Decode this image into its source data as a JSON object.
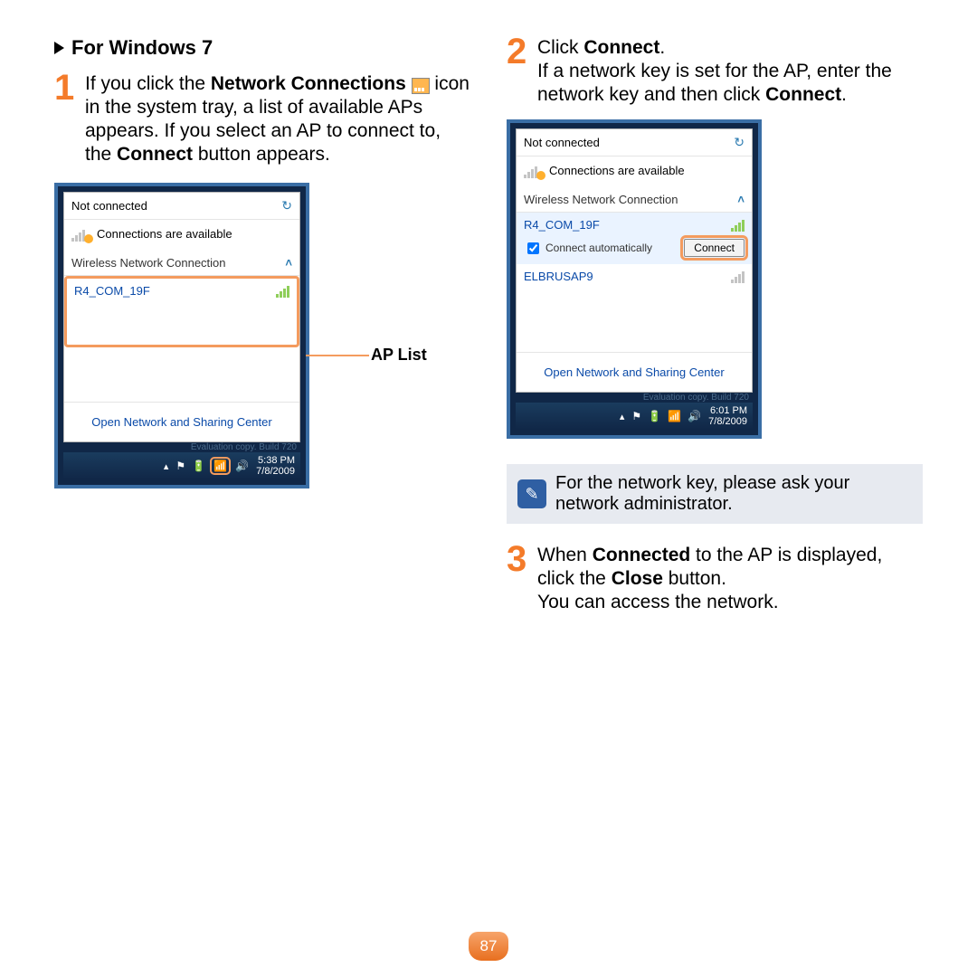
{
  "left": {
    "heading": "For Windows 7",
    "step1_num": "1",
    "step1_a": "If you click the ",
    "step1_b": "Network Connections",
    "step1_c": " icon in the system tray, a list of available APs appears. If you select an AP to connect to, the ",
    "step1_d": "Connect",
    "step1_e": " button appears.",
    "callout": "AP List",
    "popup": {
      "status": "Not connected",
      "avail": "Connections are available",
      "header": "Wireless Network Connection",
      "ap1": "R4_COM_19F",
      "open_center": "Open Network and Sharing Center",
      "eval": "Evaluation copy. Build 720",
      "time": "5:38 PM",
      "date": "7/8/2009"
    }
  },
  "right": {
    "step2_num": "2",
    "step2_a": "Click ",
    "step2_b": "Connect",
    "step2_c": ".",
    "step2_d": "If a network key is set for the AP, enter the network key and then click ",
    "step2_e": "Connect",
    "step2_f": ".",
    "popup": {
      "status": "Not connected",
      "avail": "Connections are available",
      "header": "Wireless Network Connection",
      "ap1": "R4_COM_19F",
      "auto": "Connect automatically",
      "connect": "Connect",
      "ap2": "ELBRUSAP9",
      "open_center": "Open Network and Sharing Center",
      "eval": "Evaluation copy. Build 720",
      "time": "6:01 PM",
      "date": "7/8/2009"
    },
    "note": "For the network key, please ask your network administrator.",
    "step3_num": "3",
    "step3_a": "When ",
    "step3_b": "Connected",
    "step3_c": " to the AP is displayed, click the ",
    "step3_d": "Close",
    "step3_e": " button.",
    "step3_f": "You can access the network."
  },
  "page": "87"
}
